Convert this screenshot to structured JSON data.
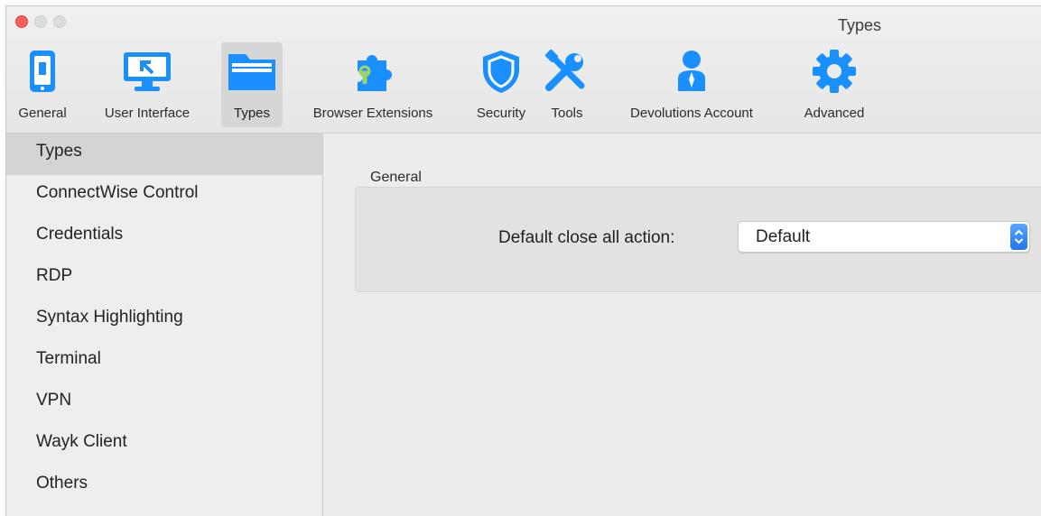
{
  "window": {
    "title": "Types"
  },
  "toolbar": {
    "items": [
      {
        "label": "General",
        "icon": "phone-icon"
      },
      {
        "label": "User Interface",
        "icon": "monitor-icon"
      },
      {
        "label": "Types",
        "icon": "folder-icon",
        "selected": true
      },
      {
        "label": "Browser Extensions",
        "icon": "puzzle-icon"
      },
      {
        "label": "Security",
        "icon": "shield-icon"
      },
      {
        "label": "Tools",
        "icon": "tools-icon"
      },
      {
        "label": "Devolutions Account",
        "icon": "user-icon"
      },
      {
        "label": "Advanced",
        "icon": "gear-icon"
      }
    ],
    "accent": "#1a8fff"
  },
  "sidebar": {
    "items": [
      {
        "label": "Types"
      },
      {
        "label": "ConnectWise Control"
      },
      {
        "label": "Credentials"
      },
      {
        "label": "RDP"
      },
      {
        "label": "Syntax Highlighting"
      },
      {
        "label": "Terminal"
      },
      {
        "label": "VPN"
      },
      {
        "label": "Wayk Client"
      },
      {
        "label": "Others"
      }
    ]
  },
  "main": {
    "group_title": "General",
    "close_all": {
      "label": "Default close all action:",
      "value": "Default"
    }
  }
}
